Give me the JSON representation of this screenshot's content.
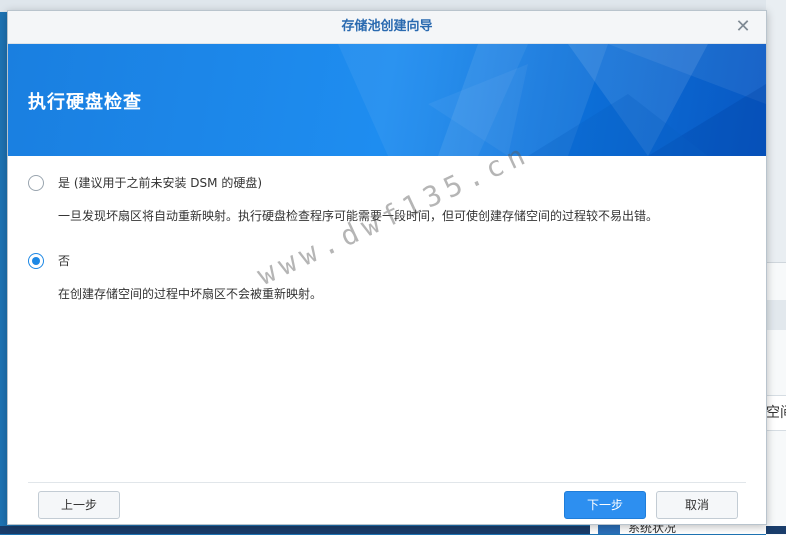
{
  "dialog": {
    "title": "存储池创建向导",
    "close_symbol": "✕"
  },
  "banner": {
    "heading": "执行硬盘检查"
  },
  "options": [
    {
      "label": "是 (建议用于之前未安装 DSM 的硬盘)",
      "description": "一旦发现坏扇区将自动重新映射。执行硬盘检查程序可能需要一段时间，但可使创建存储空间的过程较不易出错。",
      "selected": false
    },
    {
      "label": "否",
      "description": "在创建存储空间的过程中坏扇区不会被重新映射。",
      "selected": true
    }
  ],
  "footer": {
    "back_label": "上一步",
    "next_label": "下一步",
    "cancel_label": "取消"
  },
  "watermark": "www.dwf135.cn",
  "background": {
    "right_edge_text": "空间",
    "taskbar_text": "系统状况"
  },
  "colors": {
    "accent": "#2d8ff0",
    "title_text": "#2a6ab0",
    "banner_blue": "#1e8df0"
  }
}
